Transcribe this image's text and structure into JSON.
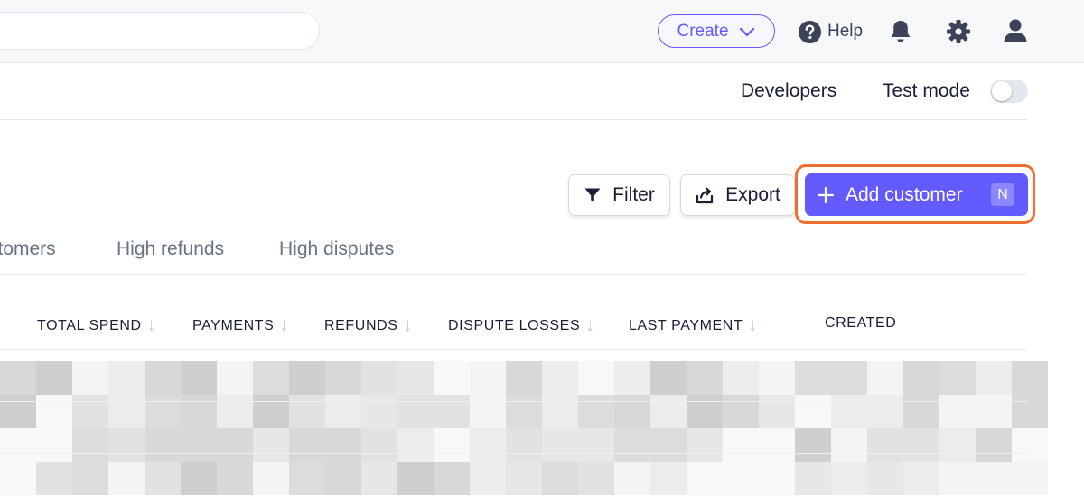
{
  "topbar": {
    "search_placeholder": "",
    "create_label": "Create",
    "help_label": "Help"
  },
  "subnav": {
    "developers_label": "Developers",
    "test_mode_label": "Test mode",
    "test_mode_on": false
  },
  "actions": {
    "filter_label": "Filter",
    "export_label": "Export",
    "add_customer_label": "Add customer",
    "add_customer_shortcut": "N"
  },
  "tabs": [
    {
      "label": "stomers"
    },
    {
      "label": "High refunds"
    },
    {
      "label": "High disputes"
    }
  ],
  "table": {
    "columns": [
      {
        "label": "TOTAL SPEND",
        "sortable": true
      },
      {
        "label": "PAYMENTS",
        "sortable": true
      },
      {
        "label": "REFUNDS",
        "sortable": true
      },
      {
        "label": "DISPUTE LOSSES",
        "sortable": true
      },
      {
        "label": "LAST PAYMENT",
        "sortable": true
      },
      {
        "label": "CREATED",
        "sortable": false
      }
    ],
    "rows_redacted": true
  },
  "colors": {
    "accent": "#635bff",
    "highlight": "#f06e30",
    "muted_text": "#697386",
    "border": "#e3e8ee"
  },
  "icons": {
    "create_chevron": "chevron-down-icon",
    "help": "help-circle-icon",
    "notifications": "bell-icon",
    "settings": "gear-icon",
    "profile": "user-icon",
    "filter": "filter-icon",
    "export": "export-icon",
    "add": "plus-icon",
    "sort": "arrow-down-icon"
  }
}
